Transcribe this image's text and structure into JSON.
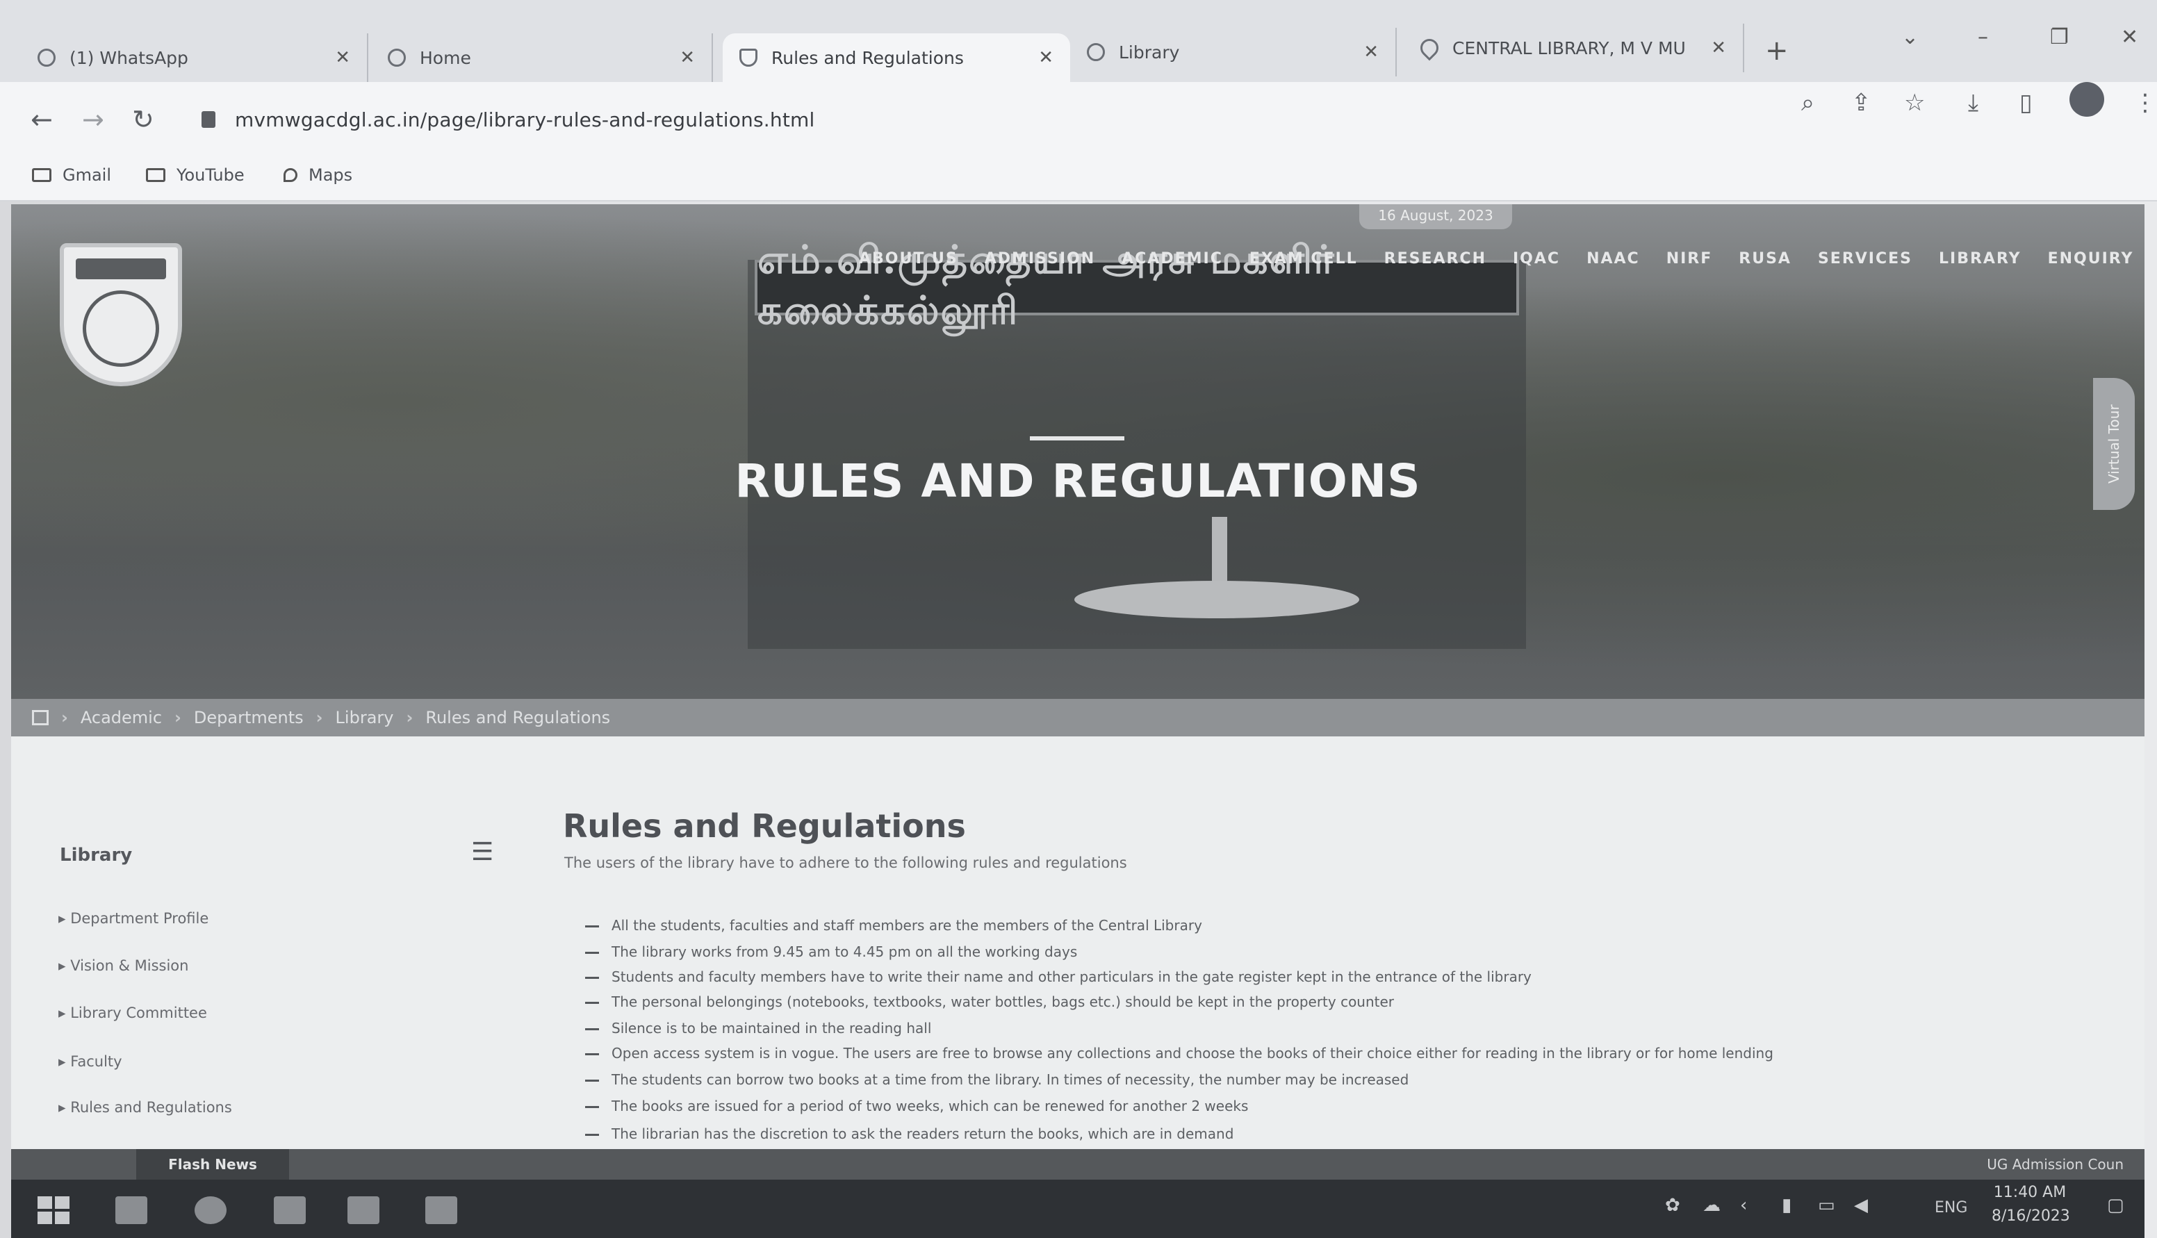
{
  "browser": {
    "tabs": [
      {
        "label": "(1) WhatsApp",
        "icon": "whatsapp-icon"
      },
      {
        "label": "Home",
        "icon": "globe-icon"
      },
      {
        "label": "Rules and Regulations",
        "icon": "shield-icon",
        "active": true
      },
      {
        "label": "Library",
        "icon": "globe-icon"
      },
      {
        "label": "CENTRAL LIBRARY, M V MU",
        "icon": "map-pin-icon"
      }
    ],
    "url": "mvmwgacdgl.ac.in/page/library-rules-and-regulations.html",
    "bookmarks": [
      "Gmail",
      "YouTube",
      "Maps"
    ]
  },
  "site": {
    "date_badge": "16 August, 2023",
    "signboard": "எம்.வி.முத்தையா அரசு மகளிர் கலைக்கல்லூரி",
    "nav": [
      "ABOUT US",
      "ADMISSION",
      "ACADEMIC",
      "EXAM CELL",
      "RESEARCH",
      "IQAC",
      "NAAC",
      "NIRF",
      "RUSA",
      "SERVICES",
      "LIBRARY",
      "ENQUIRY"
    ],
    "hero_title": "RULES AND REGULATIONS",
    "virtual_tour": "Virtual Tour",
    "breadcrumb": [
      "Academic",
      "Departments",
      "Library",
      "Rules and Regulations"
    ]
  },
  "sidebar": {
    "title": "Library",
    "items": [
      "Department Profile",
      "Vision & Mission",
      "Library Committee",
      "Faculty",
      "Rules and Regulations"
    ]
  },
  "main": {
    "title": "Rules and Regulations",
    "subtitle": "The users of the library have to adhere to the following rules and regulations",
    "rules": [
      "All the students, faculties and staff members are the members of the Central Library",
      "The library works from 9.45 am to 4.45 pm on all the working days",
      "Students and faculty members have to write their name and other particulars in the gate register kept in the entrance of the library",
      "The personal belongings (notebooks, textbooks, water bottles, bags etc.) should be kept in the property counter",
      "Silence is to be maintained in the reading hall",
      "Open access system is in vogue. The users are free to browse any collections and choose the books of their choice either for reading in the library or for home lending",
      "The students can borrow two books at a time from the library. In times of necessity, the number may be increased",
      "The books are issued for a period of two weeks, which can be renewed for another 2 weeks",
      "The librarian has the discretion to ask the readers return the books, which are in demand"
    ]
  },
  "flash": {
    "label": "Flash News",
    "news": "UG Admission Coun"
  },
  "taskbar": {
    "lang": "ENG",
    "time": "11:40 AM",
    "date": "8/16/2023"
  }
}
